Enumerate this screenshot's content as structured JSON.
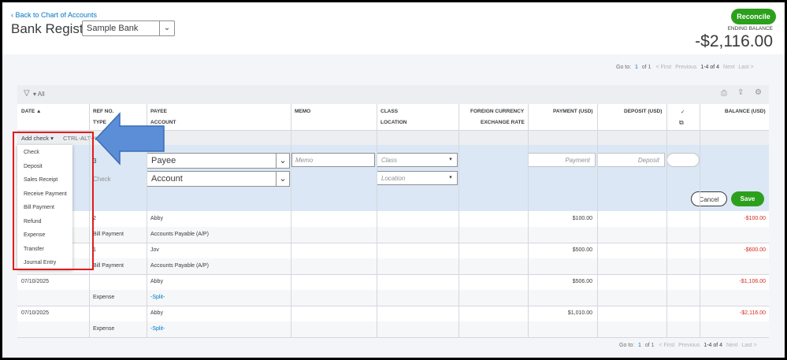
{
  "header": {
    "back_link": "Back to Chart of Accounts",
    "title": "Bank Register",
    "account": "Sample Bank",
    "reconcile": "Reconcile",
    "ending_balance_label": "ENDING BALANCE",
    "ending_balance": "-$2,116.00"
  },
  "pager": {
    "goto": "Go to:",
    "page": "1",
    "of": "of 1",
    "first": "< First",
    "previous": "Previous",
    "range": "1-4 of 4",
    "next": "Next",
    "last": "Last >"
  },
  "toolbar": {
    "filter": "All"
  },
  "columns": {
    "date": "DATE ▲",
    "ref_no": "REF NO.",
    "type": "TYPE",
    "payee": "PAYEE",
    "account": "ACCOUNT",
    "memo": "MEMO",
    "class": "CLASS",
    "location": "LOCATION",
    "foreign_currency": "FOREIGN CURRENCY",
    "exchange_rate": "EXCHANGE RATE",
    "payment": "PAYMENT (USD)",
    "deposit": "DEPOSIT (USD)",
    "check": "✓",
    "balance": "BALANCE (USD)"
  },
  "add": {
    "label": "Add check ▾",
    "shortcut": "CTRL-ALT-N"
  },
  "menu": [
    "Check",
    "Deposit",
    "Sales Receipt",
    "Receive Payment",
    "Bill Payment",
    "Refund",
    "Expense",
    "Transfer",
    "Journal Entry"
  ],
  "edit": {
    "ref": "3",
    "type": "Check",
    "payee_placeholder": "Payee",
    "account_placeholder": "Account",
    "memo_placeholder": "Memo",
    "class_placeholder": "Class",
    "location_placeholder": "Location",
    "payment_placeholder": "Payment",
    "deposit_placeholder": "Deposit",
    "cancel": "Cancel",
    "save": "Save"
  },
  "transactions": [
    {
      "date": "",
      "ref": "2",
      "type": "Bill Payment",
      "payee": "Abby",
      "account": "Accounts Payable (A/P)",
      "payment": "$100.00",
      "balance": "-$100.00"
    },
    {
      "date": "",
      "ref": "1",
      "type": "Bill Payment",
      "payee": "Jov",
      "account": "Accounts Payable (A/P)",
      "payment": "$500.00",
      "balance": "-$600.00"
    },
    {
      "date": "07/10/2025",
      "ref": "",
      "type": "Expense",
      "payee": "Abby",
      "account": "-Split-",
      "payment": "$506.00",
      "balance": "-$1,106.00"
    },
    {
      "date": "07/10/2025",
      "ref": "",
      "type": "Expense",
      "payee": "Abby",
      "account": "-Split-",
      "payment": "$1,010.00",
      "balance": "-$2,116.00"
    }
  ],
  "colors": {
    "accent": "#2ca01c",
    "link": "#0077c5",
    "negative": "#d52b1e",
    "highlight_box": "#e21b1b",
    "arrow": "#5b8ed6"
  }
}
